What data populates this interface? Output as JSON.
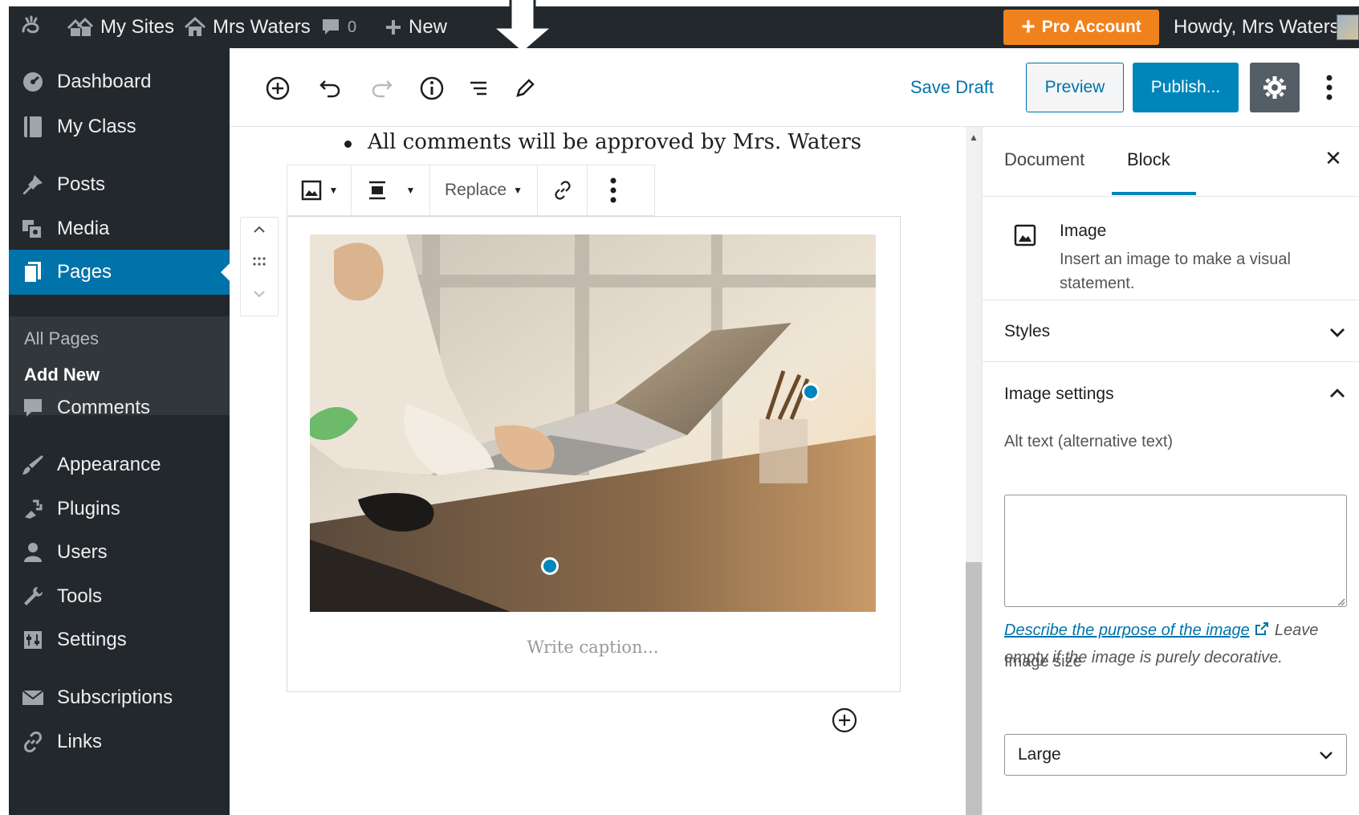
{
  "admin_bar": {
    "my_sites": "My Sites",
    "site_name": "Mrs Waters",
    "comments_count": "0",
    "new_label": "New",
    "pro_account": "Pro Account",
    "howdy": "Howdy, Mrs Waters"
  },
  "sidebar": {
    "items": [
      {
        "label": "Dashboard",
        "icon": "dashboard-icon"
      },
      {
        "label": "My Class",
        "icon": "book-icon"
      },
      {
        "label": "Posts",
        "icon": "pin-icon"
      },
      {
        "label": "Media",
        "icon": "media-icon"
      },
      {
        "label": "Pages",
        "icon": "pages-icon",
        "active": true
      },
      {
        "label": "Comments",
        "icon": "comment-icon"
      },
      {
        "label": "Appearance",
        "icon": "brush-icon"
      },
      {
        "label": "Plugins",
        "icon": "plugin-icon"
      },
      {
        "label": "Users",
        "icon": "users-icon"
      },
      {
        "label": "Tools",
        "icon": "wrench-icon"
      },
      {
        "label": "Settings",
        "icon": "settings-icon"
      },
      {
        "label": "Subscriptions",
        "icon": "mail-icon"
      },
      {
        "label": "Links",
        "icon": "link-icon"
      }
    ],
    "submenu": {
      "all_pages": "All Pages",
      "add_new": "Add New"
    }
  },
  "toolbar": {
    "save_draft": "Save Draft",
    "preview": "Preview",
    "publish": "Publish..."
  },
  "content": {
    "bullet_text": "All comments will be approved by Mrs. Waters",
    "block_toolbar": {
      "replace": "Replace"
    },
    "caption_placeholder": "Write caption..."
  },
  "panel": {
    "tab_document": "Document",
    "tab_block": "Block",
    "block_title": "Image",
    "block_description": "Insert an image to make a visual statement.",
    "styles_title": "Styles",
    "image_settings_title": "Image settings",
    "alt_text_label": "Alt text (alternative text)",
    "alt_text_value": "",
    "help_link": "Describe the purpose of the image",
    "help_rest": "Leave empty if the image is purely decorative.",
    "image_size_label": "Image size",
    "image_size_value": "Large"
  },
  "colors": {
    "admin_dark": "#23282d",
    "accent_blue": "#0073aa",
    "pro_orange": "#f0821e",
    "submenu_bg": "#32373c"
  }
}
